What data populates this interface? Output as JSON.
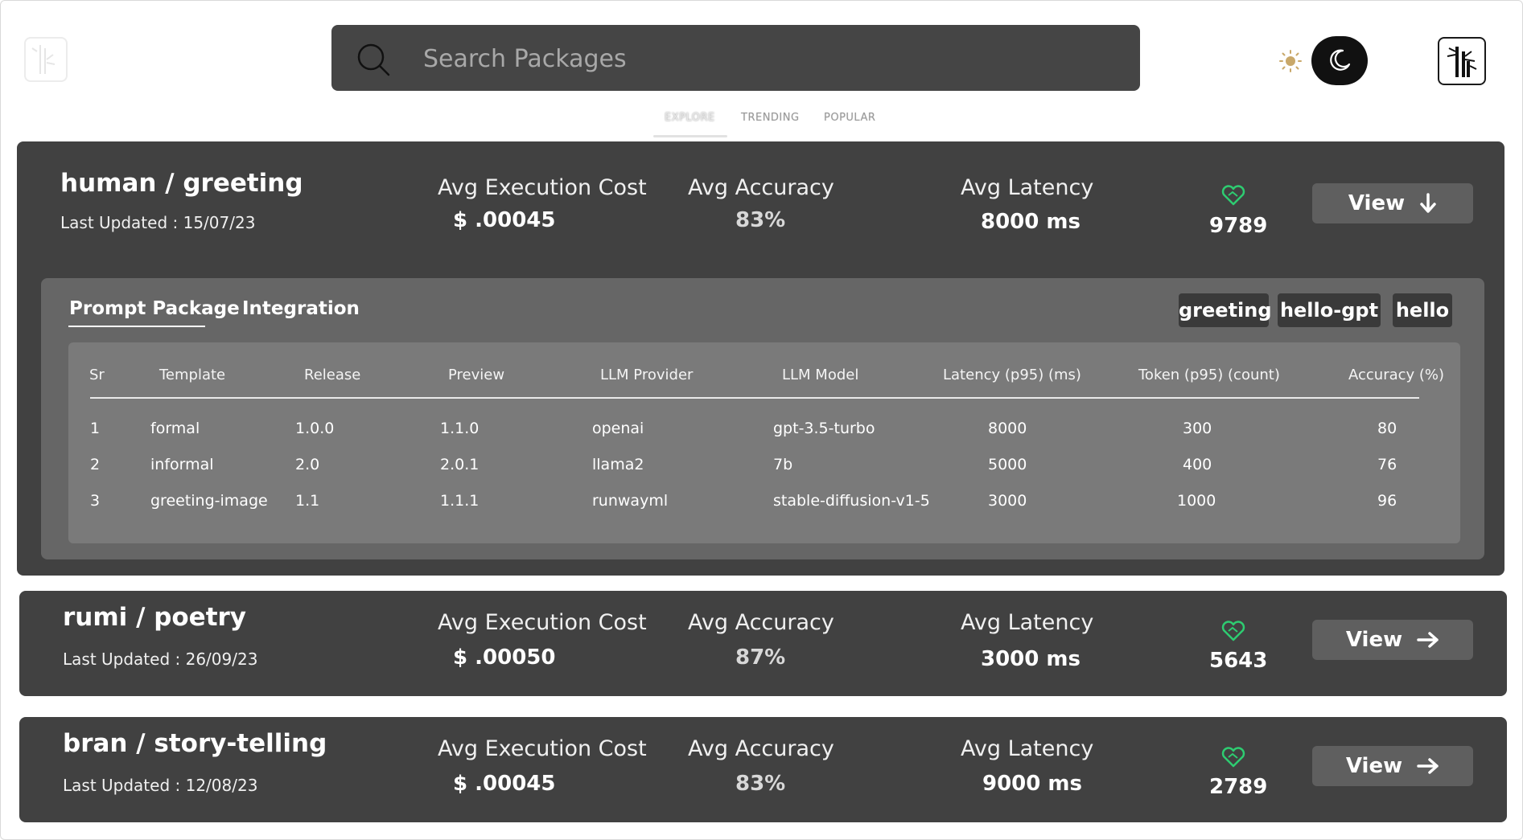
{
  "header": {
    "search_placeholder": "Search Packages",
    "icons": {
      "search": "search-icon",
      "theme_light": "sun-icon",
      "theme_dark": "moon-icon",
      "logo": "bamboo-logo-icon"
    }
  },
  "nav": {
    "tabs": [
      {
        "label": "EXPLORE",
        "active": true
      },
      {
        "label": "TRENDING",
        "active": false
      },
      {
        "label": "POPULAR",
        "active": false
      }
    ]
  },
  "labels": {
    "avg_cost": "Avg Execution Cost",
    "avg_accuracy": "Avg Accuracy",
    "avg_latency": "Avg Latency",
    "view": "View"
  },
  "packages": [
    {
      "title": "human / greeting",
      "updated": "Last Updated : 15/07/23",
      "cost": "$ .00045",
      "accuracy": "83%",
      "latency": "8000 ms",
      "likes": "9789",
      "expanded": true
    },
    {
      "title": "rumi / poetry",
      "updated": "Last Updated : 26/09/23",
      "cost": "$ .00050",
      "accuracy": "87%",
      "latency": "3000 ms",
      "likes": "5643",
      "expanded": false
    },
    {
      "title": "bran / story-telling",
      "updated": "Last Updated : 12/08/23",
      "cost": "$ .00045",
      "accuracy": "83%",
      "latency": "9000 ms",
      "likes": "2789",
      "expanded": false
    }
  ],
  "detail": {
    "tabs": [
      "Prompt Package",
      "Integration"
    ],
    "active_tab": "Prompt Package",
    "tags": [
      "greeting",
      "hello-gpt",
      "hello"
    ],
    "table": {
      "headers": [
        "Sr",
        "Template",
        "Release",
        "Preview",
        "LLM Provider",
        "LLM Model",
        "Latency (p95) (ms)",
        "Token (p95) (count)",
        "Accuracy (%)"
      ],
      "rows": [
        [
          "1",
          "formal",
          "1.0.0",
          "1.1.0",
          "openai",
          "gpt-3.5-turbo",
          "8000",
          "300",
          "80"
        ],
        [
          "2",
          "informal",
          "2.0",
          "2.0.1",
          "llama2",
          "7b",
          "5000",
          "400",
          "76"
        ],
        [
          "3",
          "greeting-image",
          "1.1",
          "1.1.1",
          "runwayml",
          "stable-diffusion-v1-5",
          "3000",
          "1000",
          "96"
        ]
      ]
    }
  },
  "colors": {
    "card_bg": "#414141",
    "panel_bg": "#666666",
    "table_bg": "#7a7a7a",
    "heart_green": "#2ecc71",
    "search_bg": "#454545"
  }
}
